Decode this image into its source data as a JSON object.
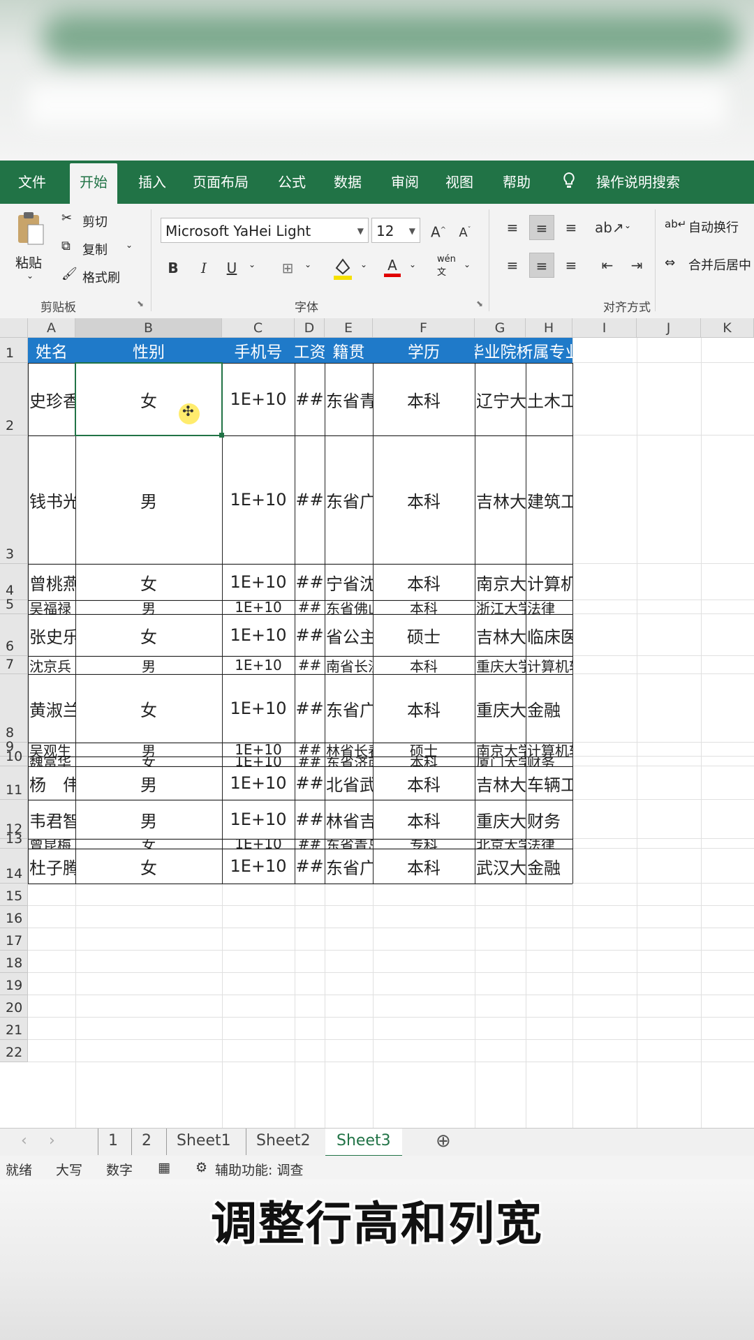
{
  "ribbon": {
    "tabs": [
      "文件",
      "开始",
      "插入",
      "页面布局",
      "公式",
      "数据",
      "审阅",
      "视图",
      "帮助"
    ],
    "active_tab": "开始",
    "search": "操作说明搜索",
    "clipboard": {
      "paste": "粘贴",
      "cut": "剪切",
      "copy": "复制",
      "format_painter": "格式刷",
      "group": "剪贴板"
    },
    "font": {
      "name": "Microsoft YaHei Light",
      "size": "12",
      "grow": "A",
      "shrink": "A",
      "bold": "B",
      "italic": "I",
      "underline": "U",
      "group": "字体",
      "font_color_glyph": "A",
      "wen": "wén"
    },
    "align": {
      "wrap": "自动换行",
      "merge": "合并后居中",
      "group": "对齐方式"
    }
  },
  "sheet": {
    "columns": [
      "A",
      "B",
      "C",
      "D",
      "E",
      "F",
      "G",
      "H",
      "I",
      "J",
      "K"
    ],
    "header_row": [
      "姓名",
      "性别",
      "手机号",
      "工资",
      "籍贯",
      "学历",
      "毕业院校",
      "所属专业"
    ],
    "header_visible": [
      "姓名",
      "性别",
      "手机号",
      "工资",
      "籍贯",
      "学历",
      "毕业院校",
      "所属专业"
    ],
    "rows": [
      {
        "n": "2",
        "a": "史珍香",
        "b": "女",
        "c": "1E+10",
        "d": "##",
        "e": "东省青岛",
        "f": "本科",
        "g": "辽宁大学",
        "h": "土木工程"
      },
      {
        "n": "3",
        "a": "钱书光",
        "b": "男",
        "c": "1E+10",
        "d": "##",
        "e": "东省广州",
        "f": "本科",
        "g": "吉林大学",
        "h": "建筑工程"
      },
      {
        "n": "4",
        "a": "曾桃燕",
        "b": "女",
        "c": "1E+10",
        "d": "##",
        "e": "宁省沈阳",
        "f": "本科",
        "g": "南京大学",
        "h": "计算机软件"
      },
      {
        "n": "5",
        "a": "吴福禄",
        "b": "男",
        "c": "1E+10",
        "d": "##",
        "e": "东省佛山",
        "f": "本科",
        "g": "浙江大学",
        "h": "法律"
      },
      {
        "n": "6",
        "a": "张史乐",
        "b": "女",
        "c": "1E+10",
        "d": "##",
        "e": "省公主岭",
        "f": "硕士",
        "g": "吉林大学",
        "h": "临床医学"
      },
      {
        "n": "7",
        "a": "沈京兵",
        "b": "男",
        "c": "1E+10",
        "d": "##",
        "e": "南省长沙",
        "f": "本科",
        "g": "重庆大学",
        "h": "计算机软件"
      },
      {
        "n": "8",
        "a": "黄淑兰",
        "b": "女",
        "c": "1E+10",
        "d": "##",
        "e": "东省广州",
        "f": "本科",
        "g": "重庆大学",
        "h": "金融"
      },
      {
        "n": "9",
        "a": "吴观生",
        "b": "男",
        "c": "1E+10",
        "d": "##",
        "e": "林省长春",
        "f": "硕士",
        "g": "南京大学",
        "h": "计算机软件"
      },
      {
        "n": "10",
        "a": "魏富华",
        "b": "女",
        "c": "1E+10",
        "d": "##",
        "e": "东省济南",
        "f": "本科",
        "g": "厦门大学",
        "h": "财务"
      },
      {
        "n": "11",
        "a": "杨　伟",
        "b": "男",
        "c": "1E+10",
        "d": "##",
        "e": "北省武汉",
        "f": "本科",
        "g": "吉林大学",
        "h": "车辆工程"
      },
      {
        "n": "12",
        "a": "韦君智",
        "b": "男",
        "c": "1E+10",
        "d": "##",
        "e": "林省吉林",
        "f": "本科",
        "g": "重庆大学",
        "h": "财务"
      },
      {
        "n": "13",
        "a": "曾昆梅",
        "b": "女",
        "c": "1E+10",
        "d": "##",
        "e": "东省青岛",
        "f": "专科",
        "g": "北京大学",
        "h": "法律"
      },
      {
        "n": "14",
        "a": "杜子腾",
        "b": "女",
        "c": "1E+10",
        "d": "##",
        "e": "东省广州",
        "f": "本科",
        "g": "武汉大学",
        "h": "金融"
      }
    ],
    "empty_rows": [
      "15",
      "16",
      "17",
      "18",
      "19",
      "20",
      "21",
      "22"
    ]
  },
  "sheet_tabs": [
    "1",
    "2",
    "Sheet1",
    "Sheet2",
    "Sheet3"
  ],
  "active_sheet": "Sheet3",
  "status": {
    "ready": "就绪",
    "caps": "大写",
    "num": "数字",
    "accessibility": "辅助功能: 调查"
  },
  "subtitle": "调整行高和列宽",
  "colors": {
    "ribbon_green": "#217346",
    "header_blue": "#1f7ac9"
  }
}
